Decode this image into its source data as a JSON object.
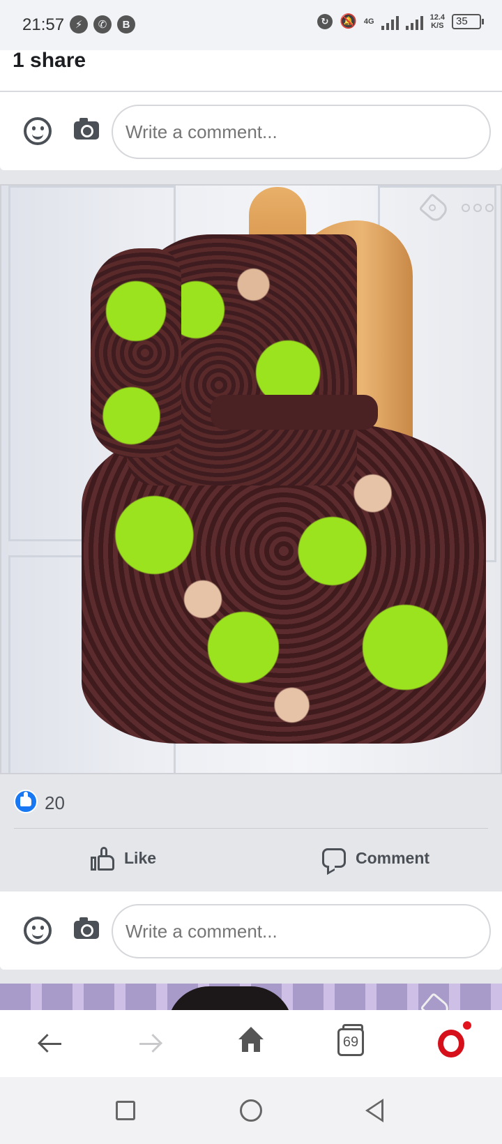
{
  "status_bar": {
    "time": "21:57",
    "network": "4G",
    "speed_value": "12.4",
    "speed_unit": "K/S",
    "battery": "35",
    "left_icons": [
      "lightning-icon",
      "whatsapp-icon",
      "b-icon"
    ],
    "right_icons": [
      "sync-icon",
      "mute-icon",
      "signal-icon",
      "signal-icon"
    ]
  },
  "post1": {
    "share_count_text": "1 share",
    "comment_placeholder": "Write a comment..."
  },
  "post2": {
    "image_icons": [
      "tag-icon",
      "more-icon"
    ],
    "like_count": "20",
    "actions": {
      "like_label": "Like",
      "comment_label": "Comment"
    },
    "comment_placeholder": "Write a comment..."
  },
  "browser_bar": {
    "tab_count": "69",
    "accent_color": "#d6101b"
  },
  "colors": {
    "facebook_blue": "#1877f2",
    "icon_gray": "#4b4f56",
    "background": "#e4e6ea"
  }
}
